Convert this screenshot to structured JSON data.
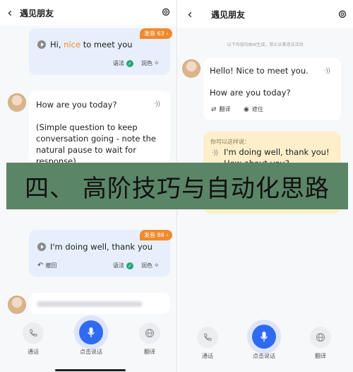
{
  "left": {
    "title": "遇见朋友",
    "msg1": {
      "pre": "Hi, ",
      "highlight": "nice",
      "post": " to meet you",
      "badge": "发音 63 ›",
      "grammar": "语法",
      "polish": "润色"
    },
    "ai1": {
      "line1": "How are you today?",
      "line2": "(Simple question to keep conversation going - note the natural pause to wait for response)"
    },
    "msg2": {
      "text": "I'm doing well, thank you",
      "badge": "发音 88 ›",
      "undo": "撤回",
      "grammar": "语法",
      "polish": "润色"
    },
    "bottom": {
      "call": "通话",
      "speak": "点击说话",
      "translate": "翻译"
    }
  },
  "right": {
    "title": "遇见朋友",
    "notice": "以下内容均由AI生成，禁止从事违法活动",
    "ai1": {
      "line1": "Hello! Nice to meet you.",
      "line2": "How are you today?",
      "translate": "翻译",
      "hide": "遮住"
    },
    "hint": {
      "label": "你可以这样说：",
      "text": "I'm doing well, thank you! How about you?"
    },
    "bottom": {
      "call": "通话",
      "speak": "点击说话",
      "translate": "翻译"
    }
  },
  "banner": {
    "text": "四、 高阶技巧与自动化思路"
  },
  "colors": {
    "accent": "#2f6bf2",
    "badge": "#f08a2c",
    "highlight": "#f08a2c",
    "banner": "#5b8567",
    "check": "#27a47a"
  }
}
